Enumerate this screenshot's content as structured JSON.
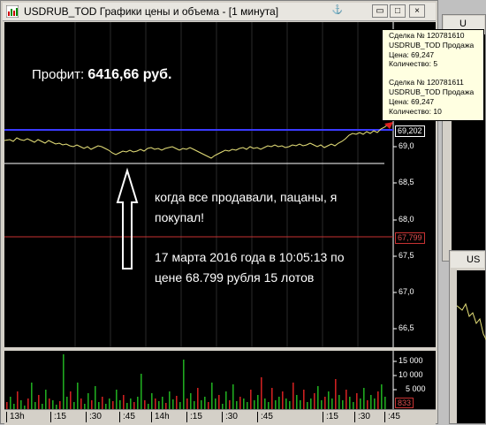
{
  "window": {
    "title": "USDRUB_TOD Графики цены и объема - [1 минута]",
    "buttons": {
      "anchor": "⚓",
      "minimize": "▭",
      "maximize": "□",
      "close": "×"
    }
  },
  "overlay": {
    "profit_label": "Профит:",
    "profit_value": "6416,66 руб.",
    "comment1": "когда все продавали, пацаны, я",
    "comment2": "покупал!",
    "comment3": "17 марта 2016 года в 10:05:13 по",
    "comment4": "цене 68.799 рубля 15 лотов"
  },
  "tooltip": {
    "deal1": {
      "title": "Сделка № 120781610",
      "name": "USDRUB_TOD Продажа",
      "price": "Цена: 69,247",
      "qty": "Количество: 5"
    },
    "deal2": {
      "title": "Сделка № 120781611",
      "name": "USDRUB_TOD Продажа",
      "price": "Цена: 69,247",
      "qty": "Количество: 10"
    }
  },
  "price_axis": {
    "ticks": [
      "69,0",
      "68,5",
      "68,0",
      "67,5",
      "67,0",
      "66,5"
    ],
    "current_price": "69,202",
    "buy_price": "67,799"
  },
  "volume_axis": {
    "ticks": [
      "15 000",
      "10 000",
      "5 000"
    ],
    "current": "833"
  },
  "time_axis": {
    "ticks": [
      "13h",
      ":15",
      ":30",
      ":45",
      "14h",
      ":15",
      ":30",
      ":45",
      ":15",
      ":30",
      ":45"
    ]
  },
  "background_windows": {
    "win1_title": "U",
    "win2_title": "US"
  },
  "colors": {
    "price_line": "#e8e27a",
    "blue_line": "#3b3bff",
    "red_line": "#c83232",
    "volume_green": "#1fa81f",
    "volume_red": "#cc2020"
  },
  "chart_data": {
    "type": "line",
    "price_ylim": [
      66.5,
      69.2
    ],
    "current_price": 69.202,
    "buy_price": 67.799,
    "volume_ylim": [
      0,
      17000
    ],
    "volume_ticks": [
      15000,
      10000,
      5000
    ],
    "x_ticks": [
      "13h",
      ":15",
      ":30",
      ":45",
      "14h",
      ":15",
      ":30",
      ":45",
      ":15",
      ":30",
      ":45"
    ]
  }
}
